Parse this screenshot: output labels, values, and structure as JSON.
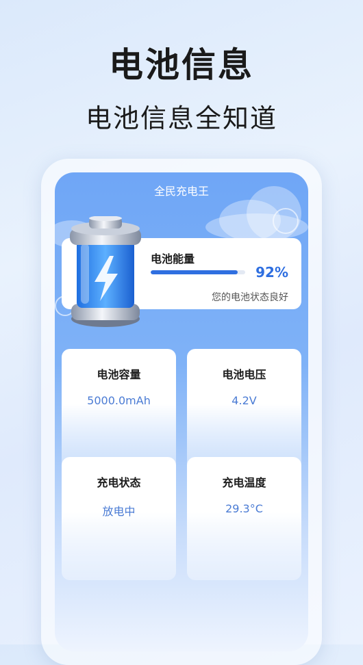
{
  "header": {
    "title": "电池信息",
    "subtitle": "电池信息全知道"
  },
  "app": {
    "title": "全民充电王"
  },
  "battery": {
    "energy_label": "电池能量",
    "percent_text": "92%",
    "level": 0.92,
    "status_text": "您的电池状态良好",
    "icon": "battery-lightning-icon"
  },
  "info_cards": [
    {
      "label": "电池容量",
      "value": "5000.0mAh"
    },
    {
      "label": "电池电压",
      "value": "4.2V"
    },
    {
      "label": "充电状态",
      "value": "放电中"
    },
    {
      "label": "充电温度",
      "value": "29.3°C"
    }
  ],
  "colors": {
    "accent": "#2f6fe0",
    "value_text": "#4a7bd4",
    "screen_top": "#6fa6f6"
  }
}
